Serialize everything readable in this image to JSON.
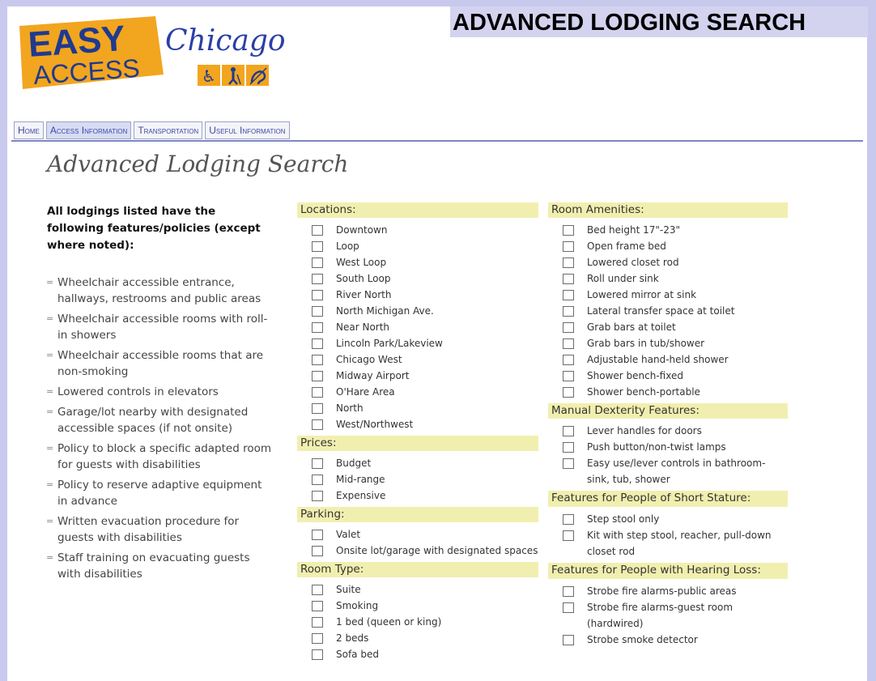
{
  "banner": {
    "title": "ADVANCED LODGING SEARCH"
  },
  "logo": {
    "line1": "EASY",
    "line2": "ACCESS",
    "script": "Chicago",
    "icons": [
      "wheelchair-icon",
      "walking-cane-icon",
      "hearing-icon"
    ],
    "colors": {
      "brand_yellow": "#f2a51f",
      "script_blue": "#2b3fa6",
      "icon_blue": "#1f3a8f"
    }
  },
  "nav": {
    "tabs": [
      {
        "label": "Home",
        "active": false
      },
      {
        "label": "Access Information",
        "active": true
      },
      {
        "label": "Transportation",
        "active": false
      },
      {
        "label": "Useful Information",
        "active": false
      }
    ]
  },
  "heading": "Advanced Lodging Search",
  "intro": "All lodgings listed have the following features/policies (except where noted):",
  "policies": [
    "Wheelchair accessible entrance, hallways, restrooms and public areas",
    "Wheelchair accessible rooms with roll-in showers",
    "Wheelchair accessible rooms that are non-smoking",
    "Lowered controls in elevators",
    "Garage/lot nearby with designated accessible spaces (if not onsite)",
    "Policy to block a specific adapted room for guests with disabilities",
    "Policy to reserve adaptive equipment in advance",
    "Written evacuation procedure for guests with disabilities",
    "Staff training on evacuating guests with disabilities"
  ],
  "col_mid": [
    {
      "title": "Locations:",
      "items": [
        "Downtown",
        "Loop",
        "West Loop",
        "South Loop",
        "River North",
        "North Michigan Ave.",
        "Near North",
        "Lincoln Park/Lakeview",
        "Chicago West",
        "Midway Airport",
        "O'Hare Area",
        "North",
        "West/Northwest"
      ]
    },
    {
      "title": "Prices:",
      "items": [
        "Budget",
        "Mid-range",
        "Expensive"
      ]
    },
    {
      "title": "Parking:",
      "items": [
        "Valet",
        "Onsite lot/garage with designated spaces"
      ]
    },
    {
      "title": "Room Type:",
      "items": [
        "Suite",
        "Smoking",
        "1 bed (queen or king)",
        "2 beds",
        "Sofa bed"
      ]
    }
  ],
  "col_right": [
    {
      "title": "Room Amenities:",
      "items": [
        "Bed height 17\"-23\"",
        "Open frame bed",
        "Lowered closet rod",
        "Roll under sink",
        "Lowered mirror at sink",
        "Lateral transfer space at toilet",
        "Grab bars at toilet",
        "Grab bars in tub/shower",
        "Adjustable hand-held shower",
        "Shower bench-fixed",
        "Shower bench-portable"
      ]
    },
    {
      "title": "Manual Dexterity Features:",
      "items": [
        "Lever handles for doors",
        "Push button/non-twist lamps",
        "Easy use/lever controls in bathroom-sink, tub, shower"
      ]
    },
    {
      "title": "Features for People of Short Stature:",
      "items": [
        "Step stool only",
        "Kit with step stool, reacher, pull-down closet rod"
      ]
    },
    {
      "title": "Features for People with Hearing Loss:",
      "items": [
        "Strobe fire alarms-public areas",
        "Strobe fire alarms-guest room (hardwired)",
        "Strobe smoke detector"
      ]
    }
  ]
}
